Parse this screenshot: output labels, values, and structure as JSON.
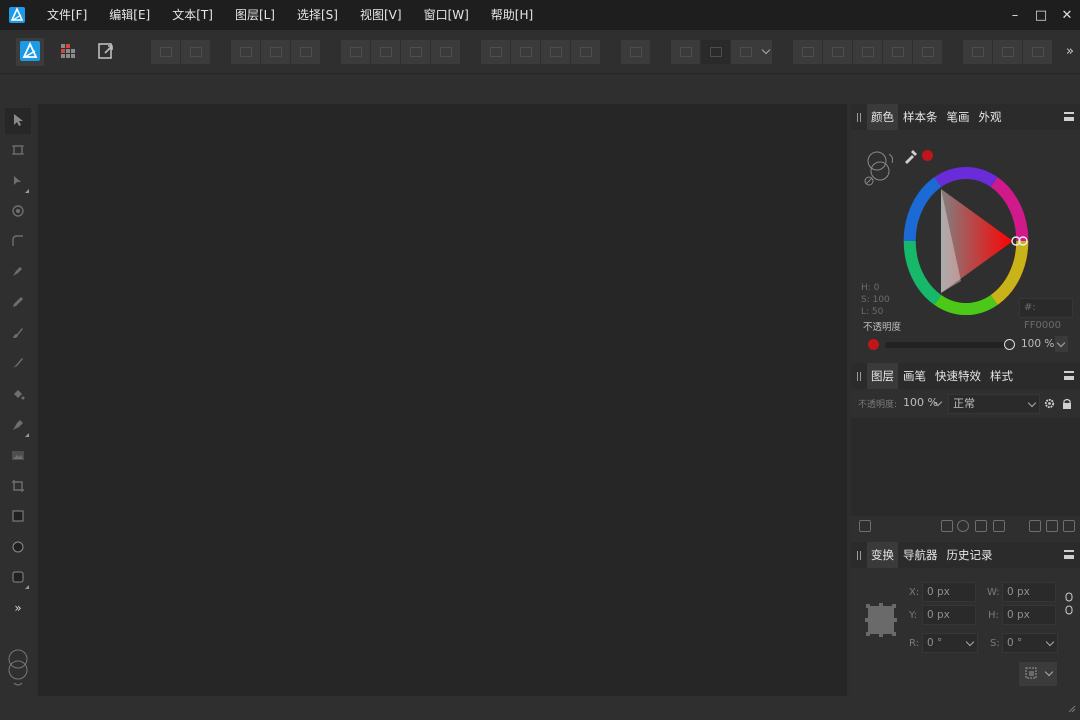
{
  "menubar": {
    "items": [
      {
        "id": "file",
        "label": "文件[F]"
      },
      {
        "id": "edit",
        "label": "编辑[E]"
      },
      {
        "id": "text",
        "label": "文本[T]"
      },
      {
        "id": "layer",
        "label": "图层[L]"
      },
      {
        "id": "select",
        "label": "选择[S]"
      },
      {
        "id": "view",
        "label": "视图[V]"
      },
      {
        "id": "window",
        "label": "窗口[W]"
      },
      {
        "id": "help",
        "label": "帮助[H]"
      }
    ],
    "window_controls": {
      "minimize": "–",
      "maximize": "□",
      "close": "✕"
    }
  },
  "toolbar": {
    "overflow": "»"
  },
  "tools": {
    "expand": "»"
  },
  "color_panel": {
    "tabs": [
      "颜色",
      "样本条",
      "笔画",
      "外观"
    ],
    "hsl": {
      "h": "H: 0",
      "s": "S: 100",
      "l": "L: 50"
    },
    "hex": "#: FF0000",
    "opacity_label": "不透明度",
    "opacity_value": "100 %",
    "current_color": "#c0161b",
    "opacity_fraction": 1.0
  },
  "layers_panel": {
    "tabs": [
      "图层",
      "画笔",
      "快速特效",
      "样式"
    ],
    "opacity_label": "不透明度:",
    "opacity_value": "100 %",
    "blend_mode": "正常"
  },
  "transform_panel": {
    "tabs": [
      "变换",
      "导航器",
      "历史记录"
    ],
    "x_label": "X:",
    "x_value": "0 px",
    "y_label": "Y:",
    "y_value": "0 px",
    "w_label": "W:",
    "w_value": "0 px",
    "h_label": "H:",
    "h_value": "0 px",
    "r_label": "R:",
    "r_value": "0 °",
    "s_label": "S:",
    "s_value": "0 °"
  },
  "colors": {
    "accent": "#2a8ae0",
    "bg": "#2e2e2e",
    "canvas": "#262626"
  }
}
